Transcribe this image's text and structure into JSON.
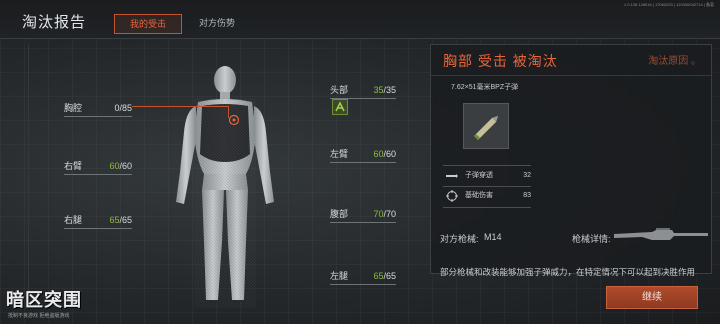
{
  "header": {
    "title": "淘汰报告",
    "tabs": [
      {
        "label": "我的受击",
        "active": true
      },
      {
        "label": "对方伤势",
        "active": false
      }
    ],
    "build_info": "1.0.128.128016 | 17062023 | 120330042714 | 备案"
  },
  "body_parts": {
    "chest": {
      "name": "胸腔",
      "current": "0",
      "max": "/85"
    },
    "right_arm": {
      "name": "右臂",
      "current": "60",
      "max": "/60"
    },
    "right_leg": {
      "name": "右腿",
      "current": "65",
      "max": "/65"
    },
    "head": {
      "name": "头部",
      "current": "35",
      "max": "/35"
    },
    "left_arm": {
      "name": "左臂",
      "current": "60",
      "max": "/60"
    },
    "abdomen": {
      "name": "腹部",
      "current": "70",
      "max": "/70"
    },
    "left_leg": {
      "name": "左腿",
      "current": "65",
      "max": "/65"
    }
  },
  "kill_panel": {
    "title": "胸部 受击 被淘汰",
    "reason_label": "淘汰原因 。",
    "ammo_name": "7.62×51毫米BPZ子弹",
    "stats": [
      {
        "label": "子弹穿透",
        "value": "32",
        "icon": "bullet-icon"
      },
      {
        "label": "基础伤害",
        "value": "83",
        "icon": "crosshair-icon"
      }
    ]
  },
  "weapon": {
    "label": "对方枪械:",
    "name": "M14",
    "detail_label": "枪械详情:"
  },
  "tip": "部分枪械和改装能够加强子弹威力，在特定情况下可以起到决胜作用",
  "continue_label": "继续",
  "logo": {
    "title": "暗区突围",
    "subtitle": "抵制不良游戏 拒绝盗版游戏"
  },
  "colors": {
    "accent": "#e8663c",
    "healthy": "#8dbb3a"
  }
}
